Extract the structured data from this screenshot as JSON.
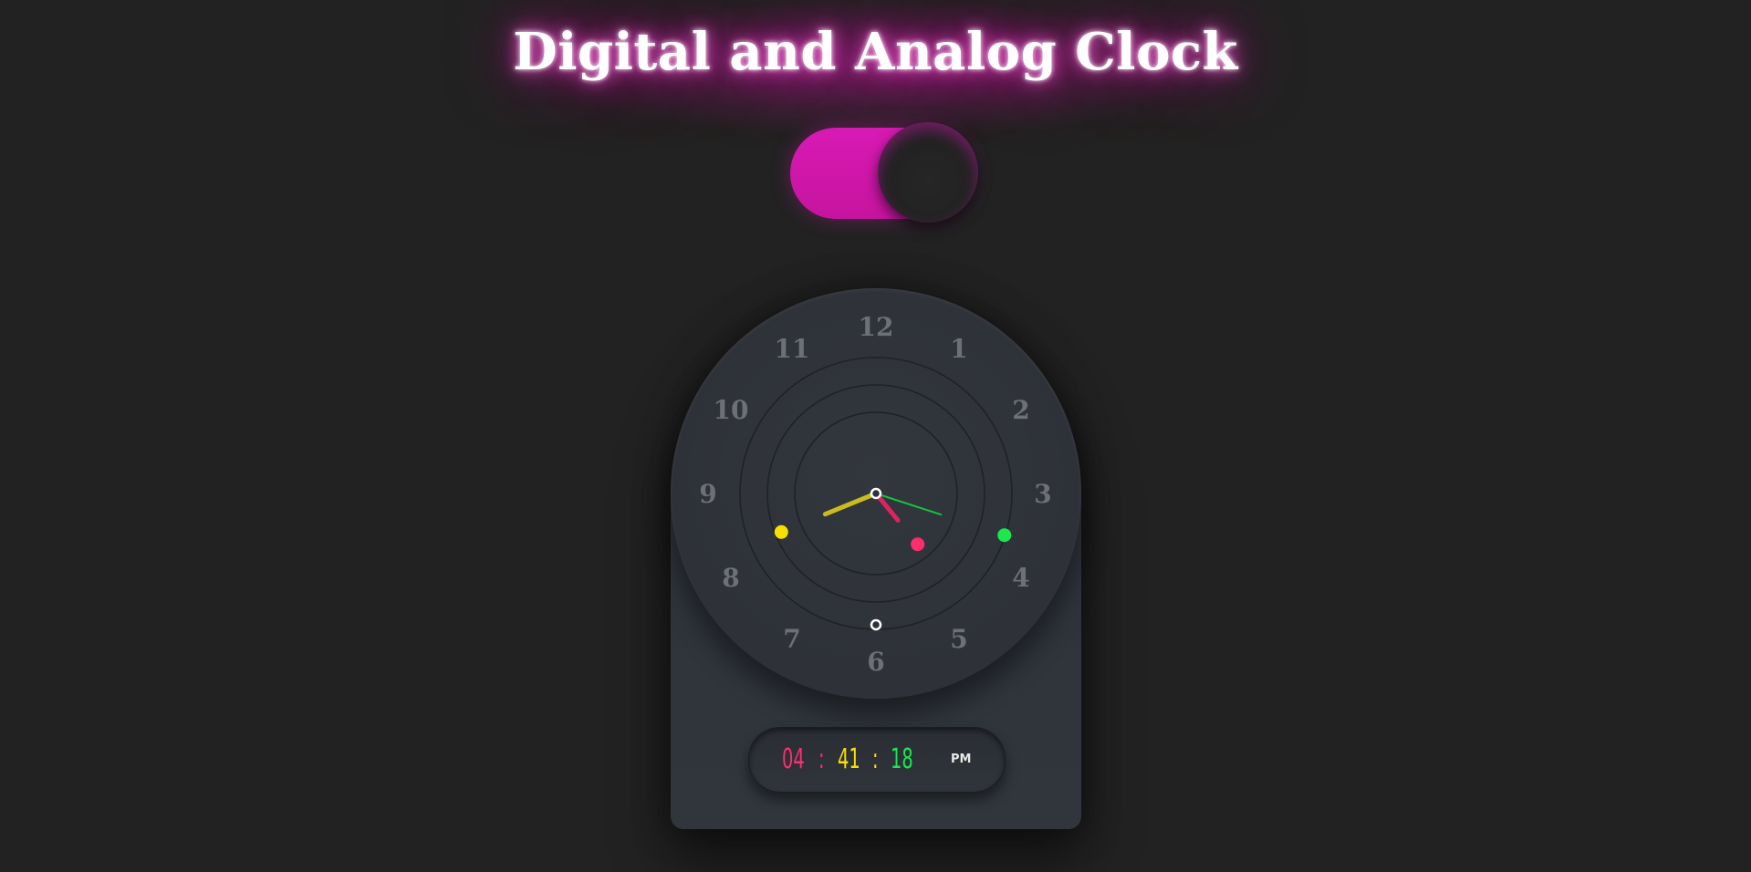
{
  "page": {
    "title": "Digital and Analog Clock"
  },
  "theme": {
    "background": "#222222",
    "accent": "#c6149f",
    "hour_color": "#ff2d6f",
    "minute_color": "#f5e000",
    "second_color": "#1ae84d"
  },
  "toggle": {
    "state": "on"
  },
  "clock": {
    "numerals": [
      "12",
      "1",
      "2",
      "3",
      "4",
      "5",
      "6",
      "7",
      "8",
      "9",
      "10",
      "11"
    ],
    "time": {
      "hours": 4,
      "minutes": 41,
      "seconds": 18
    }
  },
  "digital": {
    "hours": "04",
    "separator_1": ":",
    "minutes": "41",
    "separator_2": ":",
    "seconds": "18",
    "ampm": "PM"
  }
}
